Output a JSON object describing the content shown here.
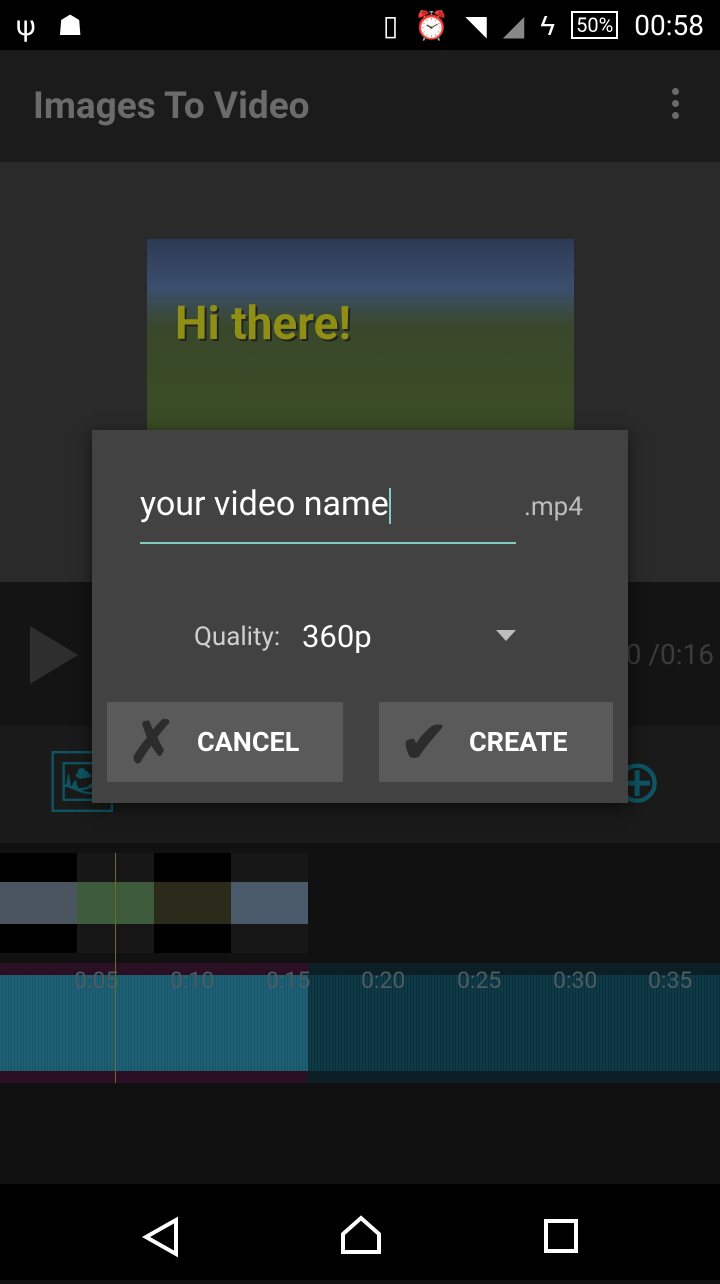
{
  "status_bar": {
    "time": "00:58",
    "battery": "50%",
    "icons": [
      "usb-icon",
      "android-debug-icon",
      "vibrate-icon",
      "alarm-icon",
      "wifi-icon",
      "signal-icon",
      "charging-icon",
      "battery-icon"
    ]
  },
  "app_bar": {
    "title": "Images To Video",
    "menu_icon": "overflow-menu-icon"
  },
  "preview": {
    "caption": "Hi there!"
  },
  "player": {
    "time": "0 /0:16"
  },
  "timeline": {
    "ticks": [
      "0:05",
      "0:10",
      "0:15",
      "0:20",
      "0:25",
      "0:30",
      "0:35"
    ]
  },
  "dialog": {
    "filename": "your video name",
    "extension": ".mp4",
    "quality_label": "Quality:",
    "quality_value": "360p",
    "cancel_label": "CANCEL",
    "create_label": "CREATE"
  },
  "colors": {
    "accent": "#80cbc4",
    "dialog_bg": "#424242",
    "wave": "#1d5f75"
  }
}
